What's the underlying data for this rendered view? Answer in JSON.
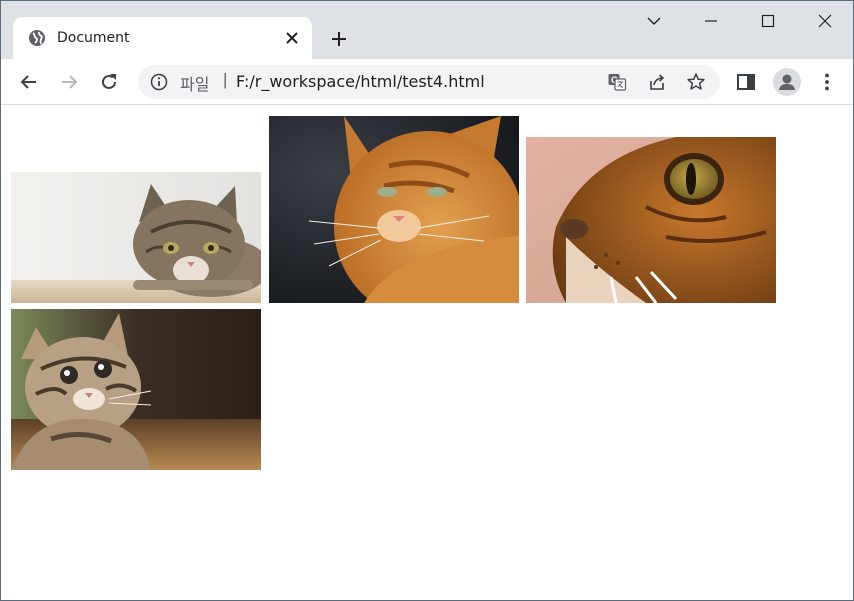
{
  "browser": {
    "tab": {
      "title": "Document"
    },
    "address_bar": {
      "scheme_label": "파일",
      "separator": "|",
      "url": "F:/r_workspace/html/test4.html"
    },
    "icons": {
      "favicon": "globe-icon",
      "tab_close": "close-icon",
      "new_tab": "plus-icon",
      "tab_search": "chevron-down-icon",
      "minimize": "minimize-icon",
      "maximize": "maximize-icon",
      "window_close": "close-icon",
      "back": "back-arrow-icon",
      "forward": "forward-arrow-icon",
      "reload": "reload-icon",
      "site_info": "info-icon",
      "translate": "translate-icon",
      "share": "share-icon",
      "bookmark": "star-icon",
      "side_panel": "side-panel-icon",
      "profile": "profile-icon",
      "menu": "kebab-menu-icon"
    }
  },
  "page": {
    "images": [
      {
        "name": "cat-lying-tabby",
        "description": "tabby cat lying down"
      },
      {
        "name": "cat-orange-portrait",
        "description": "orange cat portrait on dark background"
      },
      {
        "name": "cat-eye-closeup",
        "description": "close-up of cat face and eye"
      },
      {
        "name": "kitten-looking-up",
        "description": "tabby kitten looking up"
      }
    ]
  }
}
